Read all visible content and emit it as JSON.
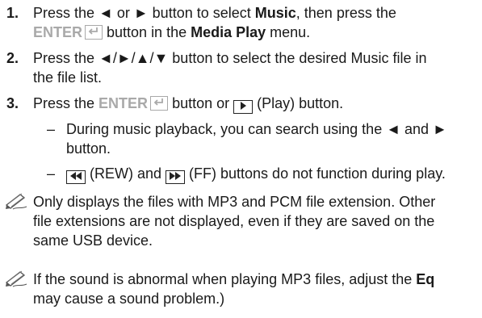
{
  "steps": [
    {
      "number": "1.",
      "line1_a": "Press the ◄ or ► button to select ",
      "line1_b": "Music",
      "line1_c": ", then press the",
      "line2_key": "ENTER",
      "line2_a": " button in the ",
      "line2_b": "Media Play",
      "line2_c": " menu."
    },
    {
      "number": "2.",
      "line1": "Press the ◄/►/▲/▼ button to select the desired Music file in",
      "line2": "the file list."
    },
    {
      "number": "3.",
      "line1_a": "Press the ",
      "line1_key": "ENTER",
      "line1_b": " button or ",
      "line1_c": " (Play) button."
    }
  ],
  "subitems": [
    {
      "dash": "–",
      "line1": "During music playback, you can search using the ◄ and ►",
      "line2": "button."
    },
    {
      "dash": "–",
      "text_a": " (REW) and ",
      "text_b": " (FF) buttons do not function during play."
    }
  ],
  "notes": [
    {
      "lines": [
        "Only displays the files with MP3 and PCM file extension. Other",
        "file extensions are not displayed, even if they are saved on the",
        "same USB device."
      ]
    },
    {
      "line1_a": "If the sound is abnormal when playing MP3 files, adjust the ",
      "line1_b": "Eq",
      "line2": "may cause a sound problem.)"
    }
  ],
  "icons": {
    "note": "note-pencil-icon",
    "enter": "enter-return-icon",
    "play": "play-button-icon",
    "rew": "rewind-button-icon",
    "ff": "fast-forward-button-icon"
  },
  "colors": {
    "text": "#1a1a1a",
    "key_gray": "#a9a9a9"
  }
}
